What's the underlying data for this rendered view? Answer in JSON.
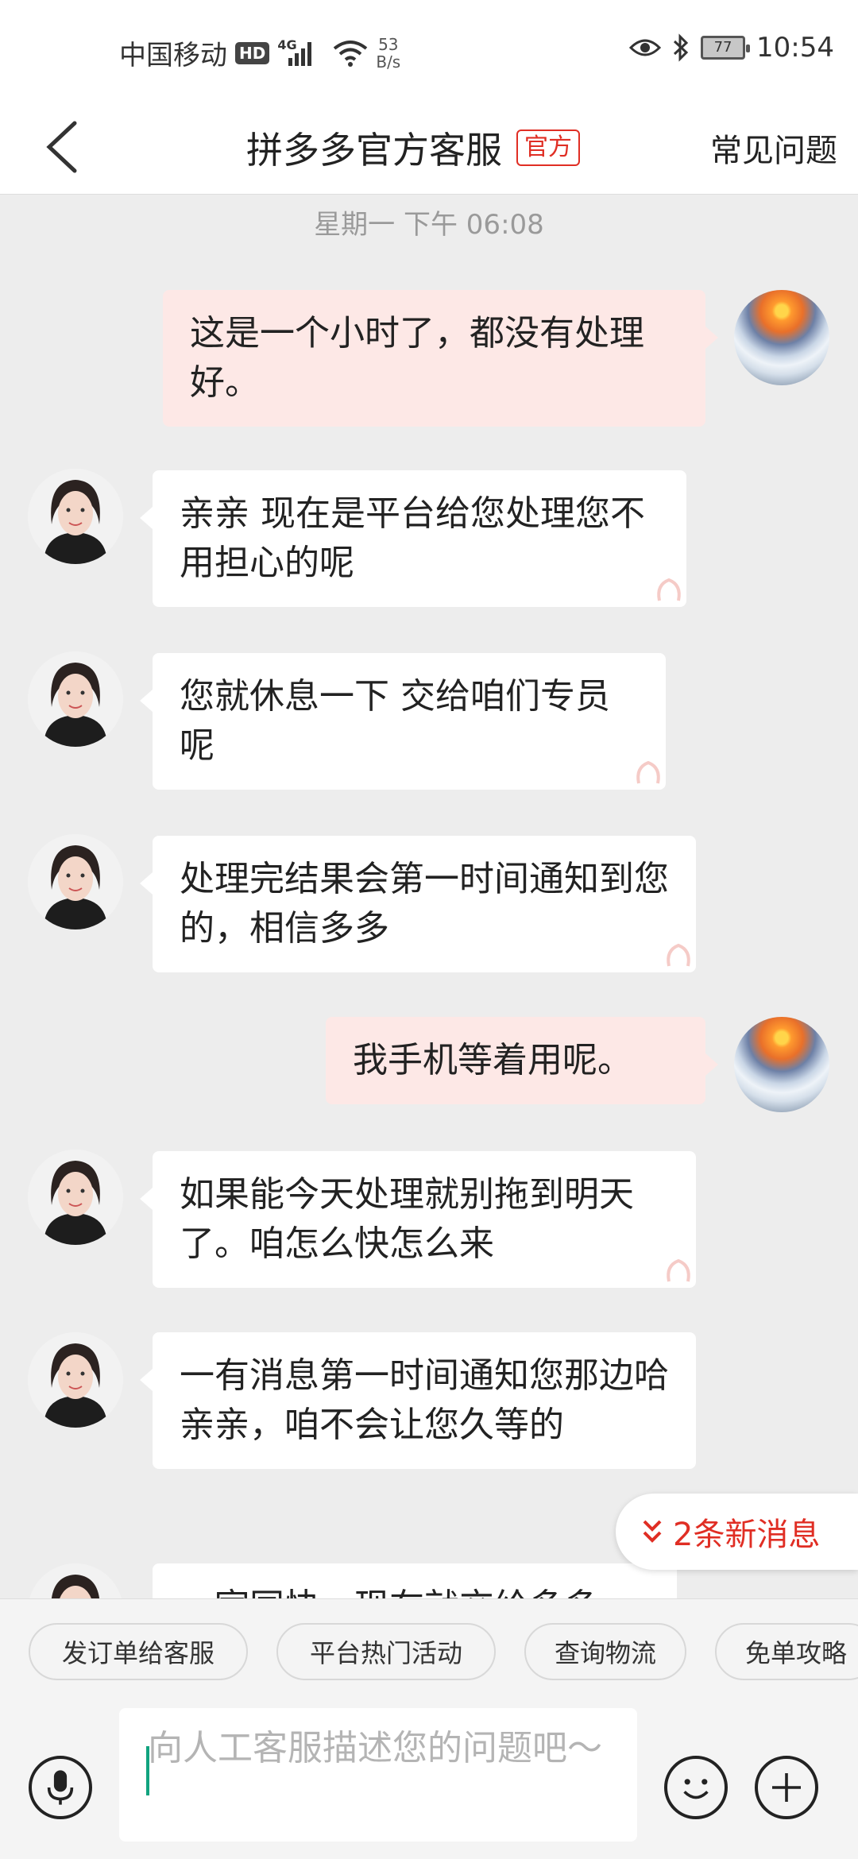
{
  "status_bar": {
    "carrier": "中国移动",
    "hd": "HD",
    "network": "4G",
    "speed_value": "53",
    "speed_unit": "B/s",
    "battery": "77",
    "time": "10:54"
  },
  "header": {
    "title": "拼多多官方客服",
    "official_badge": "官方",
    "faq_label": "常见问题"
  },
  "timestamp": "星期一 下午 06:08",
  "messages": [
    {
      "from": "user",
      "text": "这是一个小时了，都没有处理好。"
    },
    {
      "from": "agent",
      "text": "亲亲 现在是平台给您处理您不用担心的呢"
    },
    {
      "from": "agent",
      "text": "您就休息一下 交给咱们专员呢"
    },
    {
      "from": "agent",
      "text": "处理完结果会第一时间通知到您的，相信多多"
    },
    {
      "from": "user",
      "text": "我手机等着用呢。"
    },
    {
      "from": "agent",
      "text": "如果能今天处理就别拖到明天了。咱怎么快怎么来"
    },
    {
      "from": "agent",
      "text": "一有消息第一时间通知您那边哈亲亲，咱不会让您久等的"
    },
    {
      "from": "agent",
      "text": "…室同快，现在就交给多多"
    }
  ],
  "new_messages": "2条新消息",
  "quick_actions": [
    "发订单给客服",
    "平台热门活动",
    "查询物流",
    "免单攻略"
  ],
  "input": {
    "placeholder": "向人工客服描述您的问题吧～"
  },
  "icons": {
    "back": "back-arrow-icon",
    "mic": "microphone-icon",
    "emoji": "emoji-icon",
    "plus": "plus-icon",
    "new_msg": "chevron-double-down-icon"
  },
  "colors": {
    "accent": "#e02e24",
    "outgoing_bubble": "#fde8e6",
    "incoming_bubble": "#ffffff",
    "chat_background": "#ededed"
  }
}
